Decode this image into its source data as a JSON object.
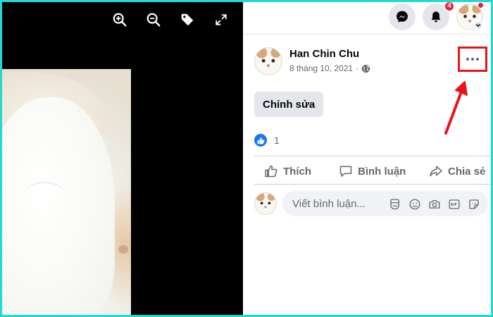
{
  "viewer": {
    "tools": [
      {
        "icon": "zoom-in-icon"
      },
      {
        "icon": "zoom-out-icon"
      },
      {
        "icon": "tag-icon"
      },
      {
        "icon": "fullscreen-icon"
      }
    ]
  },
  "topbar": {
    "messenger_icon": "messenger-icon",
    "notifications_icon": "bell-icon",
    "notification_count": "4",
    "account_icon": "avatar"
  },
  "post": {
    "author": "Han Chin Chu",
    "date": "8 tháng 10, 2021",
    "separator": "·",
    "privacy_icon": "globe-icon",
    "more_icon": "more-options-icon",
    "edit_label": "Chỉnh sửa",
    "like_count": "1",
    "actions": {
      "like": "Thích",
      "comment": "Bình luận",
      "share": "Chia sẻ"
    },
    "comment_placeholder": "Viết bình luận...",
    "comment_icons": [
      "avatar-sticker-icon",
      "emoji-icon",
      "camera-icon",
      "gif-icon",
      "sticker-icon"
    ]
  },
  "colors": {
    "accent": "#1877f2",
    "highlight": "#e8141c",
    "frame": "#25d8d0"
  }
}
